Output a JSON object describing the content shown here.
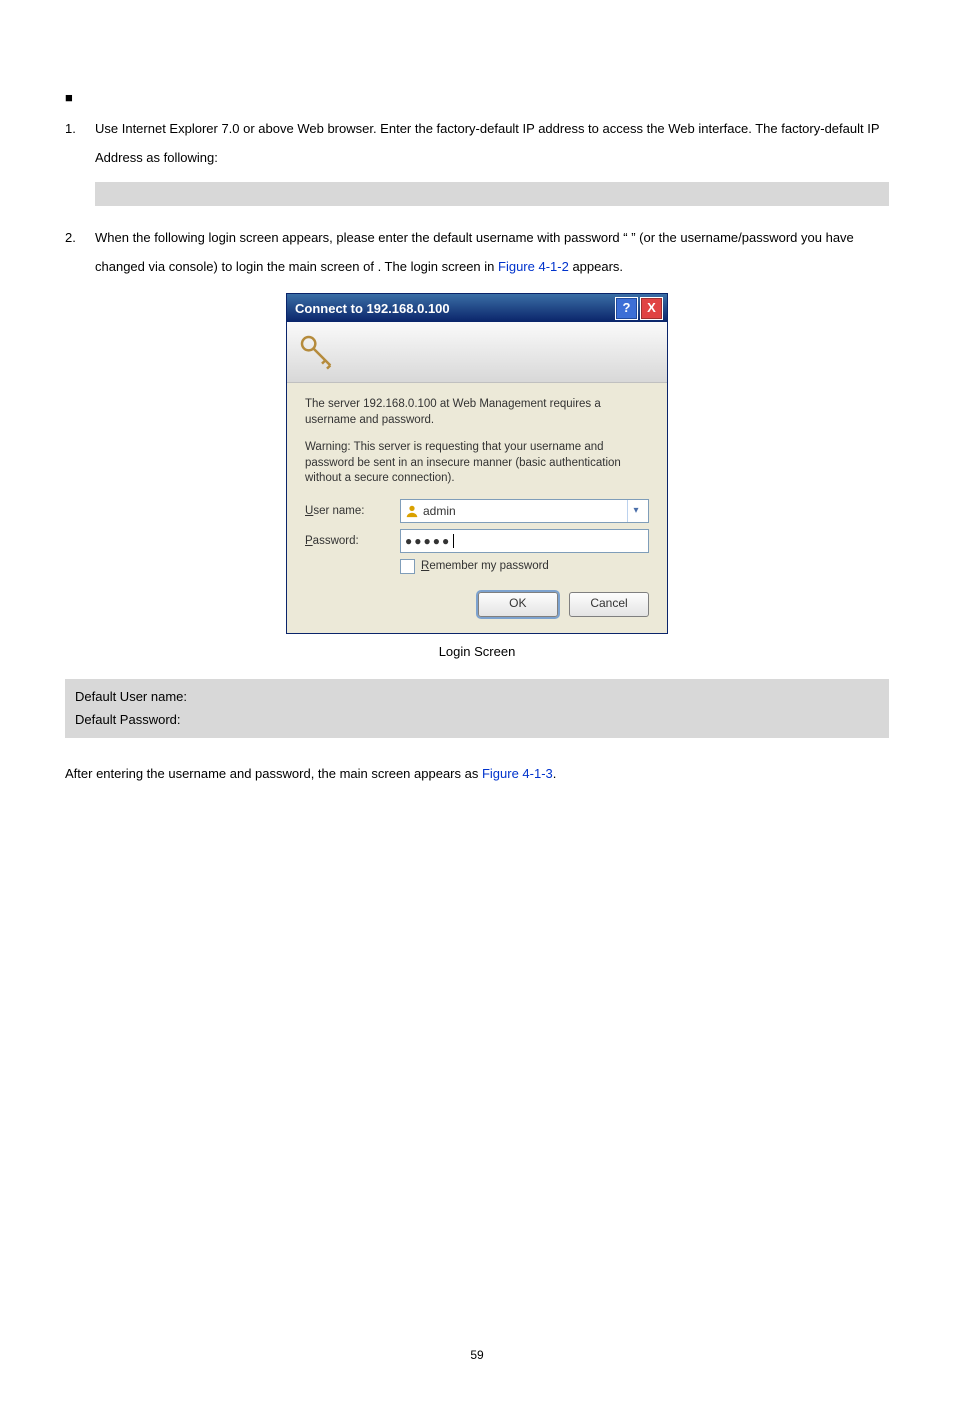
{
  "list": {
    "bullet_glyph": "■",
    "item1_num": "1.",
    "item1_text": "Use Internet Explorer 7.0 or above Web browser. Enter the factory-default IP address to access the Web interface. The factory-default IP Address as following:",
    "item2_num": "2.",
    "item2_a": "When the following login screen appears, please enter the default username ",
    "item2_b": " with password “",
    "item2_c": "” (or the username/password you have changed via console) to login the main screen of ",
    "item2_d": ". The login screen in ",
    "item2_link": "Figure 4-1-2",
    "item2_e": " appears."
  },
  "dialog": {
    "title": "Connect to 192.168.0.100",
    "help": "?",
    "close": "X",
    "msg1": "The server 192.168.0.100 at Web Management requires a username and password.",
    "msg2": "Warning: This server is requesting that your username and password be sent in an insecure manner (basic authentication without a secure connection).",
    "user_label": "User name:",
    "user_value": "admin",
    "pass_label": "Password:",
    "pass_value": "●●●●●",
    "remember": "Remember my password",
    "ok": "OK",
    "cancel": "Cancel"
  },
  "caption": "Login Screen",
  "defaults": {
    "line1": "Default User name: ",
    "line2": "Default Password: "
  },
  "after_a": "After entering the username and password, the main screen appears as ",
  "after_link": "Figure 4-1-3",
  "after_b": ".",
  "page_number": "59"
}
